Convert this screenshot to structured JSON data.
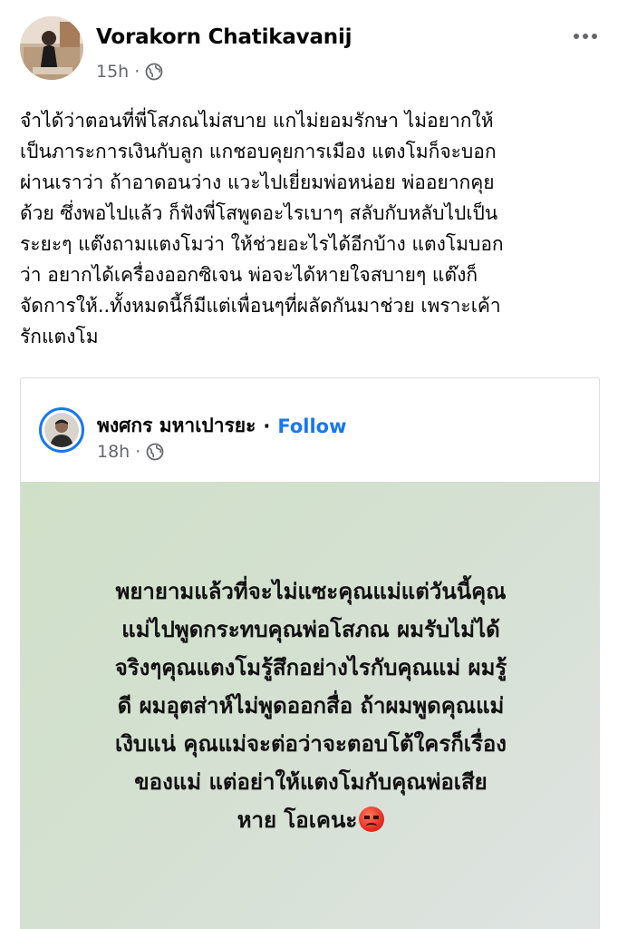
{
  "post": {
    "author": "Vorakorn Chatikavanij",
    "time": "15h",
    "audience_icon": "globe-icon",
    "more_icon": "more-horizontal-icon",
    "text_lines": [
      "จำได้ว่าตอนที่พี่โสภณไม่สบาย แกไม่ยอมรักษา ไม่อยากให้",
      "เป็นภาระการเงินกับลูก แกชอบคุยการเมือง แตงโมก็จะบอก",
      "ผ่านเราว่า ถ้าอาดอนว่าง แวะไปเยี่ยมพ่อหน่อย พ่ออยากคุย",
      "ด้วย ซึ่งพอไปแล้ว ก็ฟังพี่โสพูดอะไรเบาๆ สลับกับหลับไปเป็น",
      "ระยะๆ แต๊งถามแตงโมว่า ให้ช่วยอะไรได้อีกบ้าง แตงโมบอก",
      "ว่า อยากได้เครื่องออกซิเจน พ่อจะได้หายใจสบายๆ แต๊งก็",
      "จัดการให้..ทั้งหมดนี้ก็มีแต่เพื่อนๆที่ผลัดกันมาช่วย เพราะเค้า",
      "รักแตงโม"
    ]
  },
  "shared": {
    "author": "พงศกร มหาเปารยะ",
    "separator": "·",
    "follow_label": "Follow",
    "time": "18h",
    "audience_icon": "globe-icon",
    "bg_text_lines": [
      "พยายามแล้วที่จะไม่แซะคุณแม่แต่วันนี้คุณ",
      "แม่ไปพูดกระทบคุณพ่อโสภณ ผมรับไม่ได้",
      "จริงๆคุณแตงโมรู้สึกอย่างไรกับคุณแม่ ผมรู้",
      "ดี ผมอุตส่าห์ไม่พูดออกสื่อ ถ้าผมพูดคุณแม่",
      "เงิบแน่ คุณแม่จะต่อว่าจะตอบโต้ใครก็เรื่อง",
      "ของแม่ แต่อย่าให้แตงโมกับคุณพ่อเสีย",
      "หาย โอเคนะ"
    ],
    "emoji": "angry-face-emoji",
    "bg_colors": [
      "#cfe0c8",
      "#dfe4e3"
    ]
  },
  "colors": {
    "accent": "#1877f2",
    "meta": "#65676b",
    "text": "#050505"
  }
}
